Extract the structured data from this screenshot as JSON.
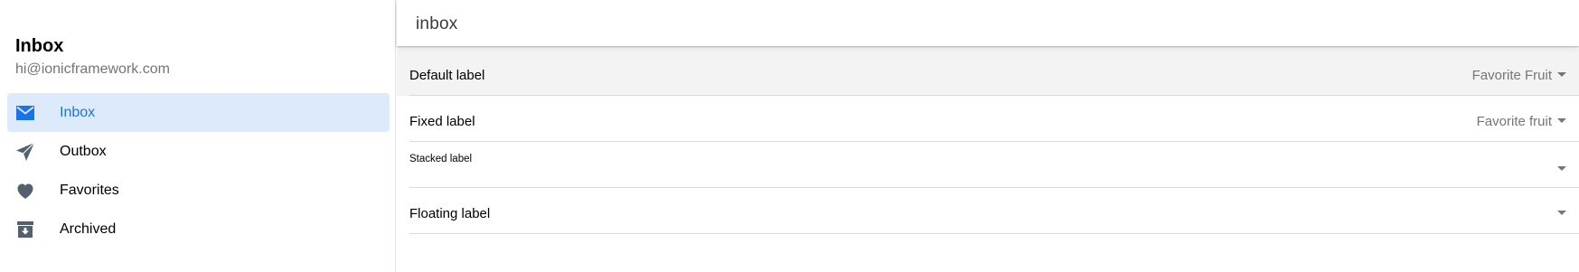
{
  "menu": {
    "title": "Inbox",
    "subtitle": "hi@ionicframework.com",
    "items": [
      {
        "label": "Inbox",
        "icon": "mail-icon",
        "selected": true
      },
      {
        "label": "Outbox",
        "icon": "paper-plane-icon",
        "selected": false
      },
      {
        "label": "Favorites",
        "icon": "heart-icon",
        "selected": false
      },
      {
        "label": "Archived",
        "icon": "archive-icon",
        "selected": false
      }
    ]
  },
  "toolbar": {
    "title": "inbox"
  },
  "list": {
    "items": [
      {
        "label": "Default label",
        "value": "Favorite Fruit"
      },
      {
        "label": "Fixed label",
        "value": "Favorite fruit"
      },
      {
        "label": "Stacked label",
        "value": ""
      },
      {
        "label": "Floating label",
        "value": ""
      }
    ]
  },
  "colors": {
    "accent": "#1a73e8",
    "selected_background": "#dceafc",
    "icon": "#54606e"
  }
}
